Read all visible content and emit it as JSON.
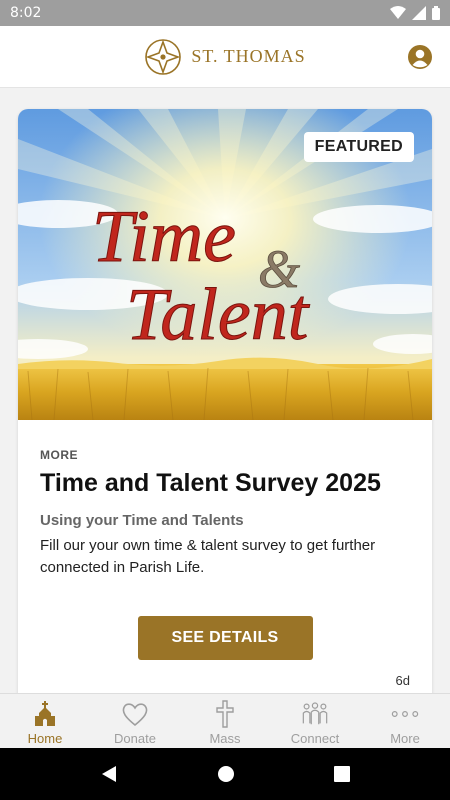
{
  "status_bar": {
    "time": "8:02"
  },
  "header": {
    "brand_name": "ST. THOMAS"
  },
  "card": {
    "badge": "FEATURED",
    "image_title_line1": "Time",
    "image_title_amp": "&",
    "image_title_line2": "Talent",
    "category": "MORE",
    "title": "Time and Talent Survey 2025",
    "subtitle": "Using your Time and Talents",
    "description": "Fill our your own time & talent survey to get further connected in Parish Life.",
    "button_label": "SEE DETAILS",
    "age": "6d"
  },
  "nav": {
    "items": [
      {
        "label": "Home",
        "icon": "church-icon",
        "active": true
      },
      {
        "label": "Donate",
        "icon": "heart-icon",
        "active": false
      },
      {
        "label": "Mass",
        "icon": "cross-icon",
        "active": false
      },
      {
        "label": "Connect",
        "icon": "people-icon",
        "active": false
      },
      {
        "label": "More",
        "icon": "ellipsis-icon",
        "active": false
      }
    ]
  },
  "colors": {
    "accent": "#9a7427",
    "inactive": "#9e9e9e",
    "status_bar": "#9e9e9e"
  }
}
